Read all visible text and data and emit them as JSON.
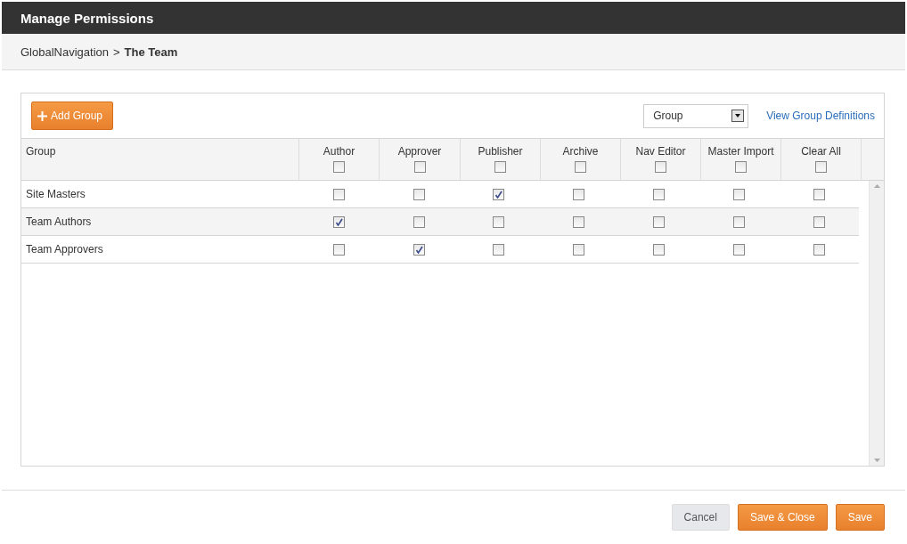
{
  "window": {
    "title": "Manage Permissions"
  },
  "breadcrumb": {
    "path": "GlobalNavigation",
    "separator": ">",
    "current": "The Team"
  },
  "toolbar": {
    "add_button": "Add Group",
    "select": {
      "value": "Group"
    },
    "link": "View Group Definitions"
  },
  "table": {
    "group_column": "Group",
    "columns": [
      {
        "label": "Author",
        "checked": false
      },
      {
        "label": "Approver",
        "checked": false
      },
      {
        "label": "Publisher",
        "checked": false
      },
      {
        "label": "Archive",
        "checked": false
      },
      {
        "label": "Nav Editor",
        "checked": false
      },
      {
        "label": "Master Import",
        "checked": false
      },
      {
        "label": "Clear All",
        "checked": false
      }
    ],
    "rows": [
      {
        "name": "Site Masters",
        "checked": [
          false,
          false,
          true,
          false,
          false,
          false,
          false
        ]
      },
      {
        "name": "Team Authors",
        "checked": [
          true,
          false,
          false,
          false,
          false,
          false,
          false
        ]
      },
      {
        "name": "Team Approvers",
        "checked": [
          false,
          true,
          false,
          false,
          false,
          false,
          false
        ]
      }
    ]
  },
  "buttons": [
    {
      "label": "Cancel",
      "kind": "secondary"
    },
    {
      "label": "Save & Close",
      "kind": "primary"
    },
    {
      "label": "Save",
      "kind": "primary"
    }
  ]
}
